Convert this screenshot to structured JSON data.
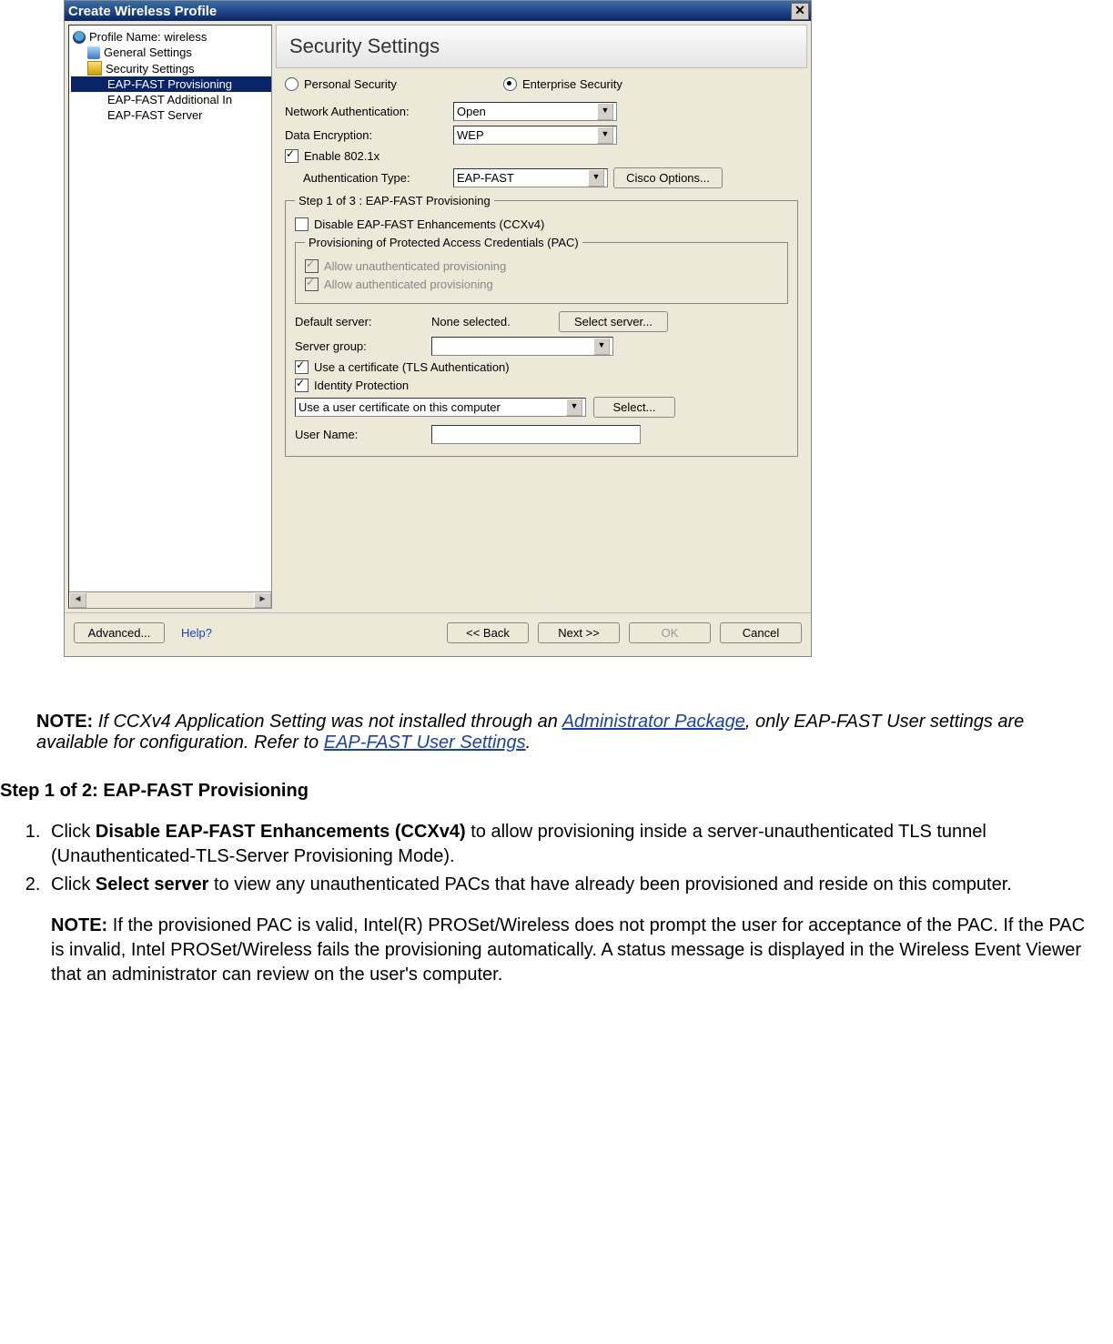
{
  "window": {
    "title": "Create Wireless Profile",
    "close_glyph": "✕"
  },
  "tree": {
    "profile": "Profile Name: wireless",
    "general": "General Settings",
    "security": "Security Settings",
    "eap_provisioning": "EAP-FAST Provisioning",
    "eap_additional": "EAP-FAST Additional In",
    "eap_server": "EAP-FAST Server"
  },
  "heading": "Security Settings",
  "radios": {
    "personal": "Personal Security",
    "enterprise": "Enterprise Security"
  },
  "labels": {
    "net_auth": "Network Authentication:",
    "data_enc": "Data Encryption:",
    "enable_8021x": "Enable 802.1x",
    "auth_type": "Authentication Type:",
    "default_server": "Default server:",
    "none_selected": "None selected.",
    "server_group": "Server group:",
    "use_cert": "Use a certificate (TLS Authentication)",
    "identity_protection": "Identity Protection",
    "user_name": "User Name:"
  },
  "selects": {
    "net_auth_value": "Open",
    "data_enc_value": "WEP",
    "auth_type_value": "EAP-FAST",
    "cert_source_value": "Use a user certificate on this computer"
  },
  "buttons": {
    "cisco": "Cisco Options...",
    "select_server": "Select server...",
    "select": "Select...",
    "advanced": "Advanced...",
    "back": "<< Back",
    "next": "Next >>",
    "ok": "OK",
    "cancel": "Cancel"
  },
  "group": {
    "step_title": "Step 1 of 3 : EAP-FAST Provisioning",
    "disable_ccxv4": "Disable EAP-FAST Enhancements (CCXv4)",
    "pac_title": "Provisioning of Protected Access Credentials (PAC)",
    "allow_unauth": "Allow unauthenticated provisioning",
    "allow_auth": "Allow authenticated provisioning"
  },
  "help_link": "Help?",
  "note1": {
    "label": "NOTE:",
    "p1a": " If CCXv4 Application Setting was not installed through an ",
    "link1": "Administrator Package",
    "p1b": ", only EAP-FAST User settings are available for configuration. Refer to ",
    "link2": "EAP-FAST User Settings",
    "p1c": "."
  },
  "step_heading": "Step 1 of 2: EAP-FAST Provisioning",
  "steps": {
    "s1a": "Click ",
    "s1b": "Disable EAP-FAST Enhancements (CCXv4)",
    "s1c": " to allow provisioning inside a server-unauthenticated TLS tunnel (Unauthenticated-TLS-Server Provisioning Mode).",
    "s2a": "Click ",
    "s2b": "Select server",
    "s2c": " to view any unauthenticated PACs that have already been provisioned and reside on this computer.",
    "s2note_label": "NOTE:",
    "s2note": " If the provisioned PAC is valid, Intel(R) PROSet/Wireless does not prompt the user for acceptance of the PAC. If the PAC is invalid, Intel PROSet/Wireless fails the provisioning automatically. A status message is displayed in the Wireless Event Viewer that an administrator can review on the user's computer."
  }
}
